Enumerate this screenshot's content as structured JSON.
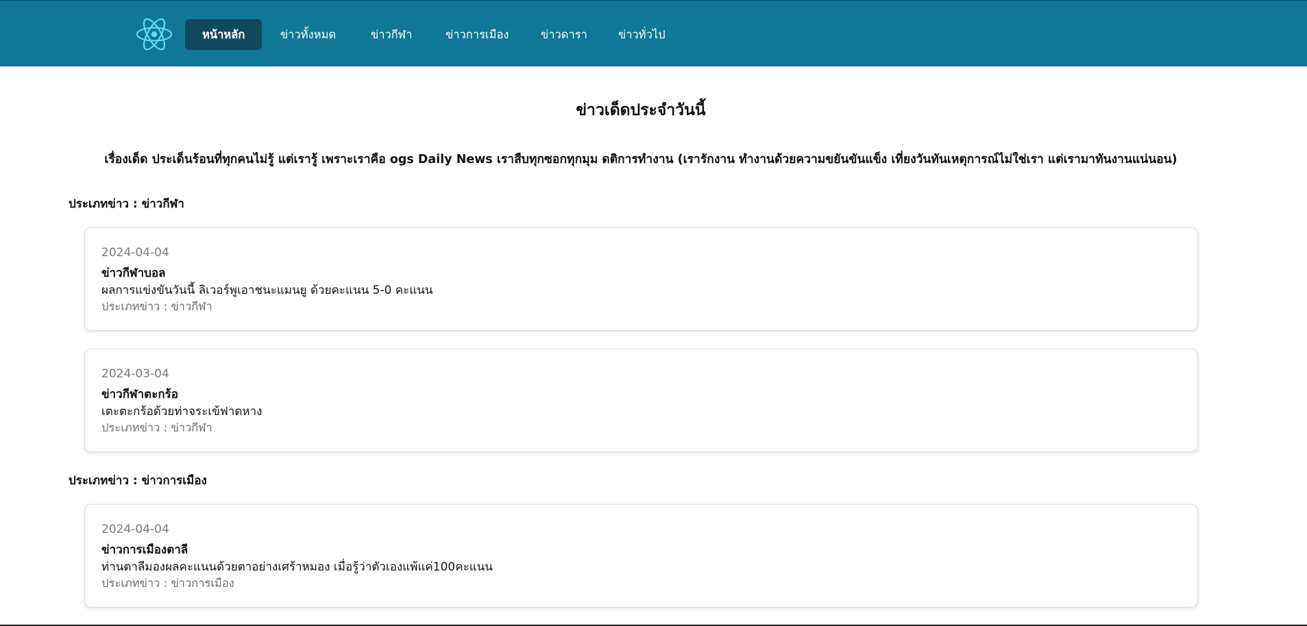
{
  "nav": {
    "logo_icon": "react-atom-icon",
    "accent_color": "#61dafb",
    "bar_color": "#107796",
    "active_color": "#114a5e",
    "items": [
      {
        "label": "หน้าหลัก",
        "active": true
      },
      {
        "label": "ข่าวทั้งหมด",
        "active": false
      },
      {
        "label": "ข่าวกีฬา",
        "active": false
      },
      {
        "label": "ข่าวการเมือง",
        "active": false
      },
      {
        "label": "ข่าวดารา",
        "active": false
      },
      {
        "label": "ข่าวทั่วไป",
        "active": false
      }
    ]
  },
  "main": {
    "title": "ข่าวเด็ดประจำวันนี้",
    "intro": "เรื่องเด็ด ประเด็นร้อนที่ทุกคนไม่รู้ แต่เรารู้ เพราะเราคือ ogs Daily News เราสืบทุกซอกทุกมุม ดติการทำงาน (เรารักงาน ทำงานด้วยความขยันขันแข็ง เที่ยงวันทันเหตุการณ์ไม่ใช่เรา แต่เรามาทันงานแน่นอน)",
    "sections": [
      {
        "heading": "ประเภทข่าว : ข่าวกีฬา",
        "items": [
          {
            "date": "2024-04-04",
            "title": "ข่าวกีฬาบอล",
            "body": "ผลการแข่งขันวันนี้ ลิเวอร์พูเอาชนะแมนยู ด้วยคะแนน 5-0 คะแนน",
            "category": "ประเภทข่าว : ข่าวกีฬา"
          },
          {
            "date": "2024-03-04",
            "title": "ข่าวกีฬาตะกร้อ",
            "body": "เตะตะกร้อด้วยท่าจระเข้ฟาดหาง",
            "category": "ประเภทข่าว : ข่าวกีฬา"
          }
        ]
      },
      {
        "heading": "ประเภทข่าว : ข่าวการเมือง",
        "items": [
          {
            "date": "2024-04-04",
            "title": "ข่าวการเมืองตาลี",
            "body": "ท่านตาลีมองผลคะแนนด้วยตาอย่างเศร้าหมอง เมื่อรู้ว่าตัวเองแพ้แค่100คะแนน",
            "category": "ประเภทข่าว : ข่าวการเมือง"
          }
        ]
      }
    ]
  }
}
